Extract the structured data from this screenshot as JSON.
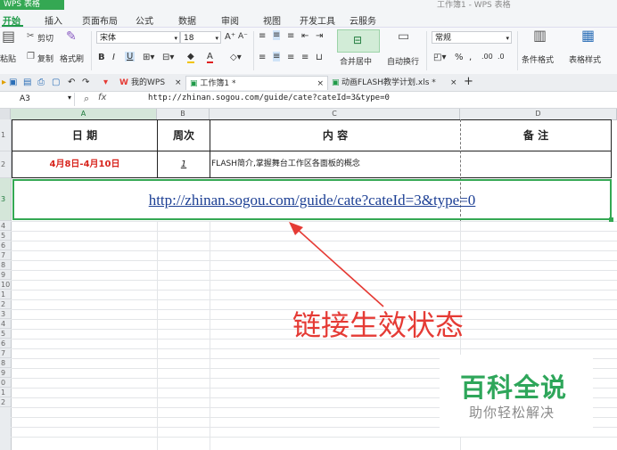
{
  "app": {
    "title": "WPS 表格",
    "title_right": "工作簿1 - WPS 表格"
  },
  "menu": {
    "items": [
      "开始",
      "插入",
      "页面布局",
      "公式",
      "数据",
      "审阅",
      "视图",
      "开发工具",
      "云服务"
    ]
  },
  "ribbon": {
    "cut": "剪切",
    "paste": "粘贴",
    "copy": "复制",
    "format_painter": "格式刷",
    "font_name": "宋体",
    "font_size": "18",
    "merge_center": "合并居中",
    "wrap_text": "自动换行",
    "number_format": "常规",
    "cond_format": "条件格式",
    "table_style": "表格样式"
  },
  "tabs": {
    "my_wps": "我的WPS",
    "workbook": "工作簿1 *",
    "flash_file": "动画FLASH教学计划.xls *"
  },
  "formula_bar": {
    "cell_ref": "A3",
    "fx": "fx",
    "content": "http://zhinan.sogou.com/guide/cate?cateId=3&type=0"
  },
  "columns": [
    "A",
    "B",
    "C",
    "D"
  ],
  "rows": [
    "1",
    "2",
    "3",
    "4",
    "5",
    "6",
    "7",
    "8",
    "9",
    "10",
    "1",
    "2",
    "3",
    "4",
    "5",
    "6",
    "7",
    "8",
    "9",
    "0",
    "1",
    "2"
  ],
  "table": {
    "headers": {
      "date": "日    期",
      "week": "周次",
      "content": "内                容",
      "note": "备    注"
    },
    "row2": {
      "date": "4月8日-4月10日",
      "week": "1",
      "content": "FLASH简介,掌握舞台工作区各面板的概念",
      "note": ""
    },
    "link": "http://zhinan.sogou.com/guide/cate?cateId=3&type=0"
  },
  "annotation": "链接生效状态",
  "watermark": {
    "title": "百科全说",
    "subtitle": "助你轻松解决"
  },
  "colors": {
    "accent": "#34a853",
    "link": "#1c3f94",
    "annotation": "#e53b35"
  }
}
